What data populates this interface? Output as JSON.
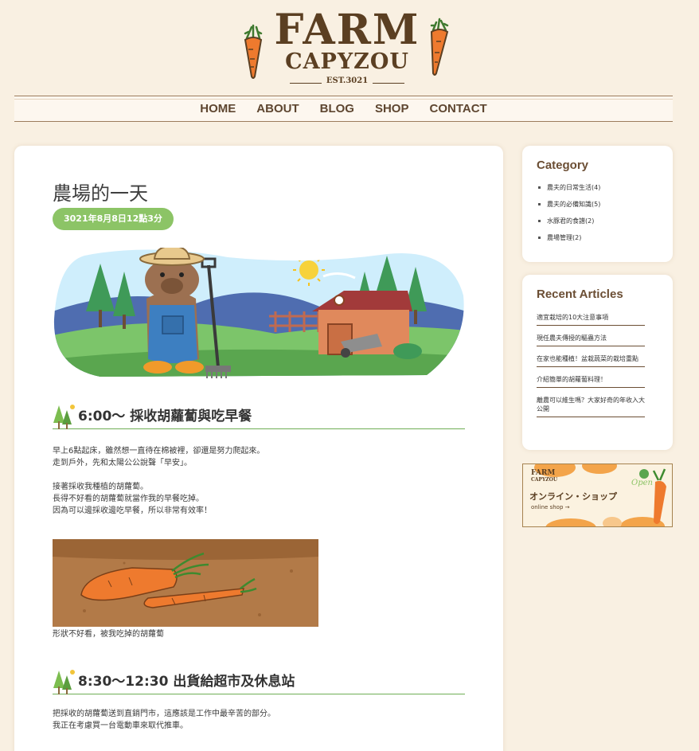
{
  "logo": {
    "top": "FARM",
    "bottom": "CAPYZOU",
    "est": "EST.3021"
  },
  "nav": [
    "HOME",
    "ABOUT",
    "BLOG",
    "SHOP",
    "CONTACT"
  ],
  "article": {
    "title": "農場的一天",
    "date": "3021年8月8日12點3分",
    "sections": [
      {
        "heading": "6:00～ 採收胡蘿蔔與吃早餐",
        "lines": [
          "早上6點起床，雖然想一直待在棉被裡，卻還是努力爬起來。",
          "走到戶外，先和太陽公公說聲「早安」。",
          "",
          "接著採收我種植的胡蘿蔔。",
          "長得不好看的胡蘿蔔就當作我的早餐吃掉。",
          "因為可以邊採收邊吃早餐，所以非常有效率！"
        ],
        "caption": "形狀不好看，被我吃掉的胡蘿蔔"
      },
      {
        "heading": "8:30～12:30 出貨給超市及休息站",
        "lines": [
          "把採收的胡蘿蔔送到直銷門市，這應該是工作中最辛苦的部分。",
          "我正在考慮買一台電動車來取代推車。"
        ]
      }
    ]
  },
  "sidebar": {
    "category_title": "Category",
    "categories": [
      "農夫的日常生活(4)",
      "農夫的必備知識(5)",
      "水豚君的食譜(2)",
      "農場管理(2)"
    ],
    "recent_title": "Recent Articles",
    "recent": [
      "適宜栽培的10大注意事項",
      "現任農夫傳授的驅蟲方法",
      "在家也能種植！盆栽蔬菜的栽培重點",
      "介紹簡單的胡蘿蔔料理！",
      "離農可以維生嗎？大家好奇的年收入大公開"
    ],
    "banner": {
      "logo_top": "FARM",
      "logo_bottom": "CAPYZOU",
      "title": "オンライン・ショップ",
      "sub": "online shop →",
      "open": "Open"
    }
  },
  "colors": {
    "background": "#f9f0e2",
    "brown": "#5b3f22",
    "green_badge": "#8cc466",
    "carrot": "#ee7a2e"
  }
}
